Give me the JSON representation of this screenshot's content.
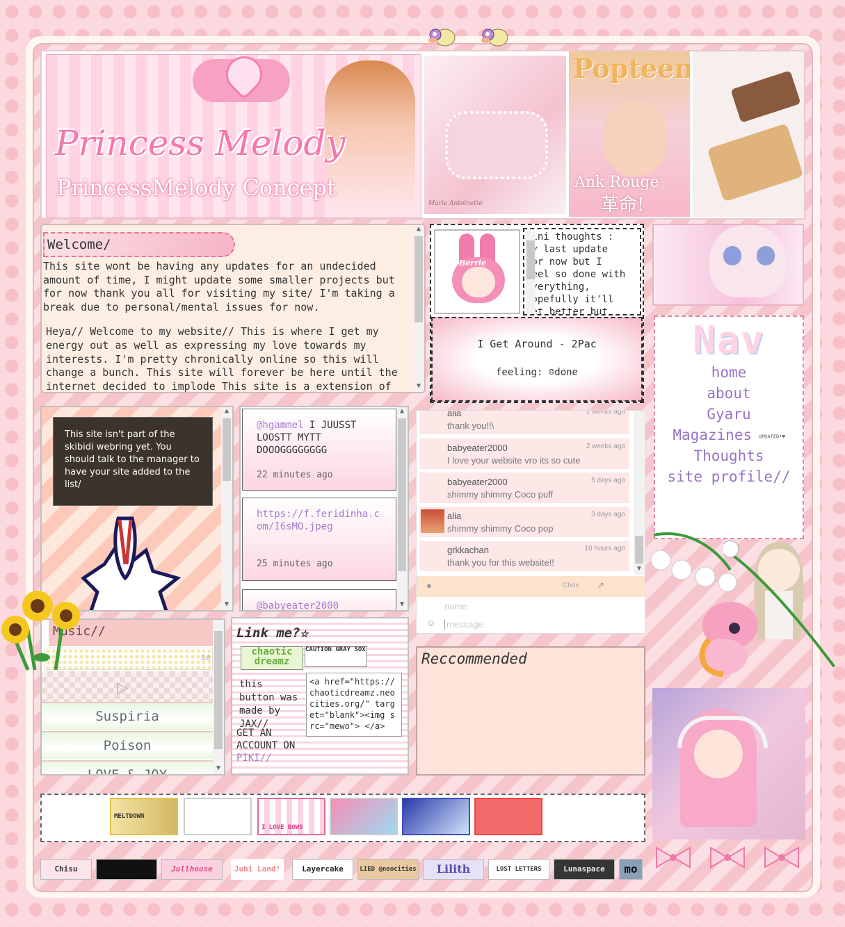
{
  "welcome": {
    "title": "Welcome/",
    "para1": "This site wont be having any updates for an undecided amount of time, I might update some smaller projects but for now thank you all for visiting my site/ I'm taking a break due to personal/mental issues for now.",
    "para2": "Heya// Welcome to my website// This is where I get my energy out as well as expressing my love towards my interests. I'm pretty chronically online so this will change a bunch. This site will forever be here until the internet decided to implode This site is a extension of myself, and my passion"
  },
  "header": {
    "banner_title": "Princess Melody",
    "banner_subtitle": "PrincessMelody Concept",
    "banner2_caption": "Marie Antoinette",
    "magazine_name": "Popteen",
    "magazine_sub1": "Ank Rouge",
    "magazine_sub2": "革命!"
  },
  "mini": {
    "bunny_label": "Berrie",
    "thoughts": "Mini thoughts : My last update for now but I feel so done with everything, hopefully it'll get better but honestly",
    "song": "I Get Around - 2Pac",
    "feeling": "feeling: ☹done"
  },
  "nav": {
    "title": "Nav",
    "items": [
      "home",
      "about",
      "Gyaru",
      "Magazines",
      "Thoughts",
      "site profile//"
    ],
    "updated_badge": "UPDATED!♥"
  },
  "webring": {
    "message": "This site isn't part of the skibidi webring yet. You should talk to the manager to have your site added to the list/"
  },
  "comments": [
    {
      "user": "@hgammel",
      "text": "I JUUSST LOOSTT MYTT DOOOGGGGGGGG",
      "time": "22 minutes ago"
    },
    {
      "user": "",
      "text": "https://f.feridinha.com/I6sMO.jpeg",
      "time": "25 minutes ago"
    },
    {
      "user": "@babyeater2000",
      "text": "",
      "time": ""
    }
  ],
  "cbox": {
    "messages": [
      {
        "name": "alia",
        "text": "thank you!!\\",
        "time": "2 weeks ago"
      },
      {
        "name": "babyeater2000",
        "text": "I love your website vro its so cute",
        "time": "2 weeks ago"
      },
      {
        "name": "babyeater2000",
        "text": "shimmy shimmy Coco puff",
        "time": "5 days ago"
      },
      {
        "name": "alia",
        "text": "shimmy shimmy Coco pop",
        "time": "3 days ago"
      },
      {
        "name": "grkkachan",
        "text": "thank you for this website!!",
        "time": "10 hours ago"
      }
    ],
    "brand": "Cbox",
    "name_placeholder": "name",
    "message_placeholder": "message"
  },
  "music": {
    "title": "Music//",
    "search_label": "se",
    "tracks": [
      "Suspiria",
      "Poison",
      "LOVE & JOY"
    ]
  },
  "linkme": {
    "title": "Link me?☆",
    "button1": "chaotic dreamz",
    "button2": "CAUTION GRAY SOX",
    "credit": "this button was made by JAX//",
    "get_account": "GET AN ACCOUNT ON",
    "piki": "PIKI//",
    "code": "<a href=\"https://chaoticdreamz.neocities.org/\" target=\"blank\"><img src=\"mewo\"> </a>"
  },
  "recommended": {
    "title": "Reccommended"
  },
  "buttons": {
    "meltdown": "MELTDOWN",
    "bows": "I LOVE BOWS",
    "strip": [
      "Chisu",
      "",
      "Jullhouse",
      "Jubi Land!",
      "Layercake",
      "LIED @neocities",
      "Lilith",
      "LOST LETTERS",
      "Lunaspace",
      "mo"
    ]
  },
  "colors": {
    "accent_pink": "#f06ea0",
    "nav_purple": "#9874c5",
    "link_purple": "#a57ad3"
  }
}
